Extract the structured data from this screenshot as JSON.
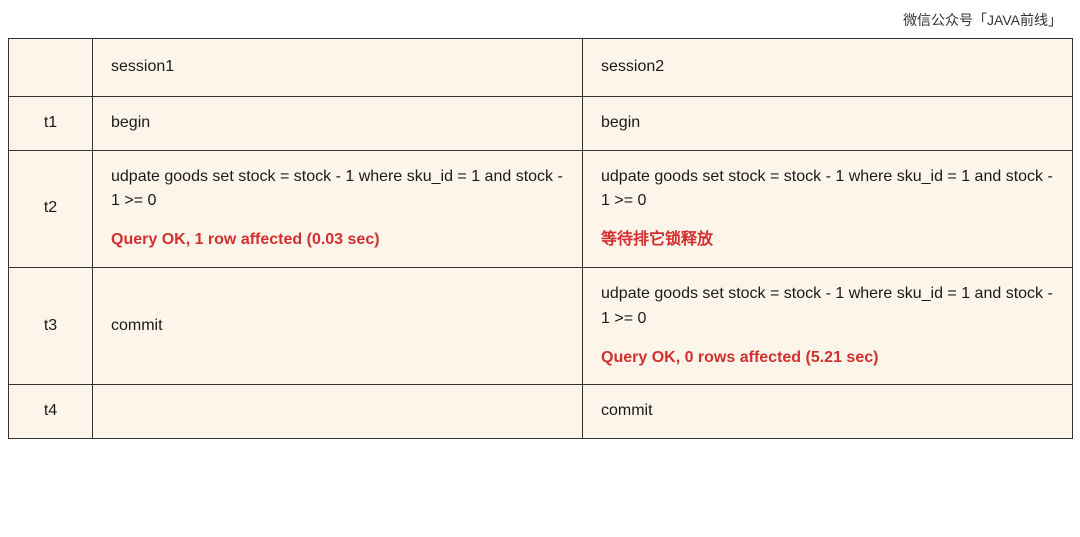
{
  "caption": "微信公众号「JAVA前线」",
  "headers": {
    "time": "",
    "s1": "session1",
    "s2": "session2"
  },
  "rows": {
    "t1": {
      "time": "t1",
      "s1": {
        "line1": "begin"
      },
      "s2": {
        "line1": "begin"
      }
    },
    "t2": {
      "time": "t2",
      "s1": {
        "line1": "udpate goods set stock = stock - 1 where sku_id = 1 and stock - 1 >= 0",
        "line2": "Query OK, 1 row affected (0.03 sec)"
      },
      "s2": {
        "line1": "udpate goods set stock = stock - 1 where sku_id = 1 and stock - 1 >= 0",
        "line2": "等待排它锁释放"
      }
    },
    "t3": {
      "time": "t3",
      "s1": {
        "line1": "commit"
      },
      "s2": {
        "line1": "udpate goods set stock = stock - 1 where sku_id = 1 and stock - 1 >= 0",
        "line2": "Query OK, 0 rows affected (5.21 sec)"
      }
    },
    "t4": {
      "time": "t4",
      "s1": {
        "line1": ""
      },
      "s2": {
        "line1": "commit"
      }
    }
  }
}
